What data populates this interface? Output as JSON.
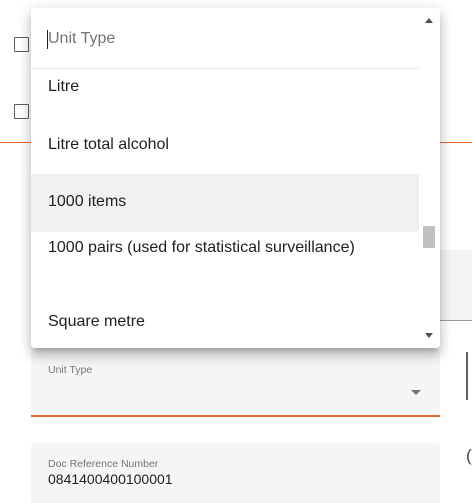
{
  "dropdown": {
    "search_placeholder": "Unit Type",
    "options": [
      {
        "label": "Litre"
      },
      {
        "label": "Litre total alcohol"
      },
      {
        "label": "1000 items",
        "highlighted": true
      },
      {
        "label": "1000 pairs (used for statistical surveillance)"
      },
      {
        "label": "Square metre"
      }
    ]
  },
  "form": {
    "unit_type": {
      "label": "Unit Type",
      "value": ""
    },
    "doc_reference": {
      "label": "Doc Reference Number",
      "value": "0841400400100001"
    }
  },
  "colors": {
    "accent": "#e8692c",
    "field_bg": "#f5f5f5",
    "highlight": "#f1f1f1",
    "text": "#212121",
    "secondary_text": "#757575"
  }
}
